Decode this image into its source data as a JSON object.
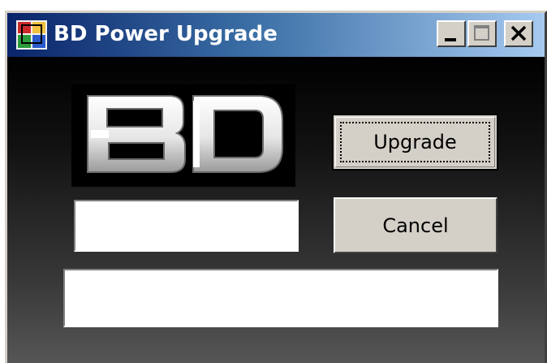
{
  "window": {
    "title": "BD Power Upgrade",
    "icon": "app-icon"
  },
  "titlebar_buttons": {
    "minimize": "minimize-icon",
    "maximize": "maximize-icon",
    "close": "close-icon"
  },
  "logo": {
    "text": "BD"
  },
  "buttons": {
    "upgrade_label": "Upgrade",
    "cancel_label": "Cancel"
  },
  "inputs": {
    "code_value": "",
    "status_value": ""
  },
  "colors": {
    "title_gradient_start": "#0a246a",
    "title_gradient_end": "#a6caf0",
    "button_face": "#d4d0c8",
    "client_bg_top": "#000000",
    "client_bg_bottom": "#565656"
  }
}
